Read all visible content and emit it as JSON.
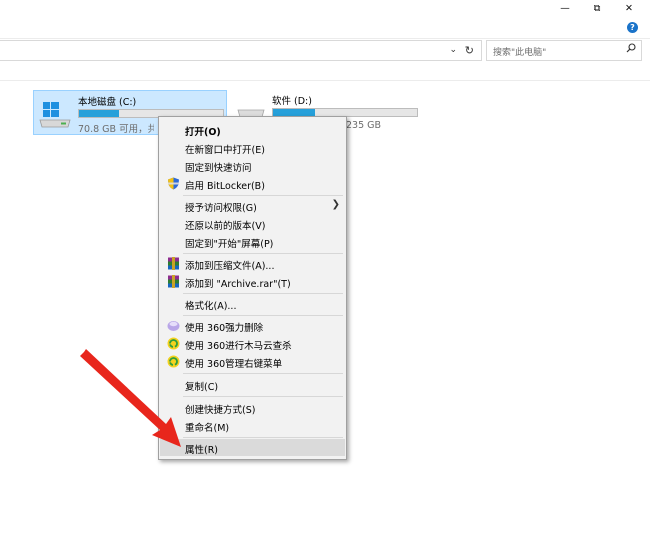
{
  "window": {
    "controls": {
      "minimize": "—",
      "maximize": "⧉",
      "close": "✕"
    },
    "help": "?"
  },
  "address_bar": {
    "dropdown": "⌄",
    "refresh": "↻"
  },
  "search": {
    "placeholder": "搜索\"此电脑\"",
    "icon": "search-icon"
  },
  "drives": [
    {
      "name": "本地磁盘 (C:)",
      "info": "70.8 GB 可用，共",
      "used_fraction": 0.28,
      "selected": true
    },
    {
      "name": "软件 (D:)",
      "info": "235 GB",
      "used_fraction": 0.29,
      "selected": false
    }
  ],
  "context_menu": {
    "items": [
      {
        "label": "打开(O)",
        "bold": true
      },
      {
        "label": "在新窗口中打开(E)"
      },
      {
        "label": "固定到快速访问"
      },
      {
        "label": "启用 BitLocker(B)",
        "icon": "shield-icon"
      },
      {
        "label": "授予访问权限(G)",
        "submenu": true
      },
      {
        "label": "还原以前的版本(V)"
      },
      {
        "label": "固定到\"开始\"屏幕(P)"
      },
      {
        "label": "添加到压缩文件(A)...",
        "icon": "winrar-icon"
      },
      {
        "label": "添加到 \"Archive.rar\"(T)",
        "icon": "winrar-icon"
      },
      {
        "label": "格式化(A)..."
      },
      {
        "label": "使用 360强力删除",
        "icon": "360-delete-icon"
      },
      {
        "label": "使用 360进行木马云查杀",
        "icon": "360-scan-icon"
      },
      {
        "label": "使用 360管理右键菜单",
        "icon": "360-manage-icon"
      },
      {
        "label": "复制(C)"
      },
      {
        "label": "创建快捷方式(S)"
      },
      {
        "label": "重命名(M)"
      },
      {
        "label": "属性(R)",
        "highlighted": true
      }
    ],
    "submenu_arrow": "❯"
  },
  "colors": {
    "selection_bg": "#cce8ff",
    "drive_bar_fill": "#26a0da",
    "annotation_arrow": "#e8261c",
    "menu_bg": "#f2f2f2"
  }
}
